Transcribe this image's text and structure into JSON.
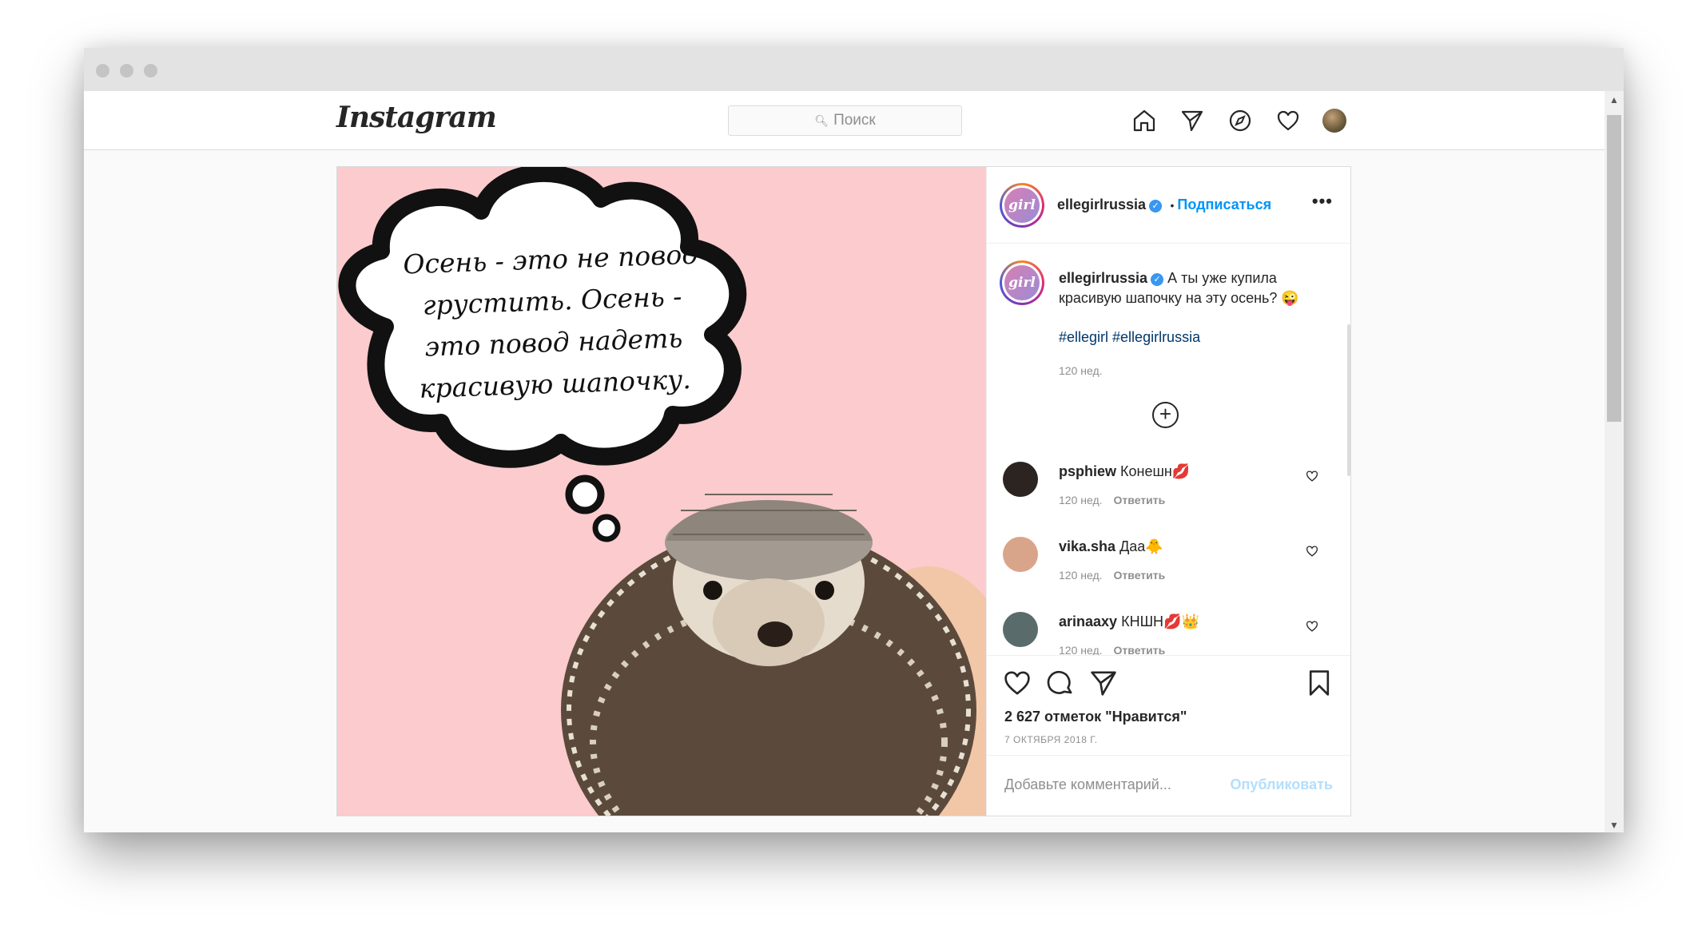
{
  "header": {
    "logo": "Instagram",
    "search_placeholder": "Поиск"
  },
  "post": {
    "image_text": "Осень - это не повод грустить. Осень - это повод надеть красивую шапочку.",
    "author": {
      "username": "ellegirlrussia",
      "avatar_text": "girl",
      "follow_label": "Подписаться",
      "separator": "•"
    },
    "caption": {
      "username": "ellegirlrussia",
      "text": "А ты уже купила красивую шапочку на эту осень? 😜",
      "hashtags": "#ellegirl #ellegirlrussia",
      "time": "120 нед."
    },
    "comments": [
      {
        "username": "psphiew",
        "text": "Конешн💋",
        "time": "120 нед.",
        "reply": "Ответить",
        "avatar_color": "#2b2420"
      },
      {
        "username": "vika.sha",
        "text": "Даа🐥",
        "time": "120 нед.",
        "reply": "Ответить",
        "avatar_color": "#d9a58a"
      },
      {
        "username": "arinaaxy",
        "text": "КНШН💋👑",
        "time": "120 нед.",
        "reply": "Ответить",
        "avatar_color": "#5a6b6b"
      }
    ],
    "likes": "2 627 отметок \"Нравится\"",
    "date": "7 ОКТЯБРЯ 2018 Г.",
    "add_comment_placeholder": "Добавьте комментарий...",
    "publish_label": "Опубликовать"
  },
  "colors": {
    "image_bg": "#fbcbcd",
    "link_blue": "#0095f6",
    "hashtag": "#00376b",
    "publish_disabled": "#b2dffc"
  },
  "icons": [
    "home-icon",
    "direct-icon",
    "explore-icon",
    "heart-icon",
    "more-icon",
    "add-icon",
    "like-icon",
    "comment-icon",
    "share-icon",
    "bookmark-icon",
    "verified-icon",
    "search-icon"
  ]
}
